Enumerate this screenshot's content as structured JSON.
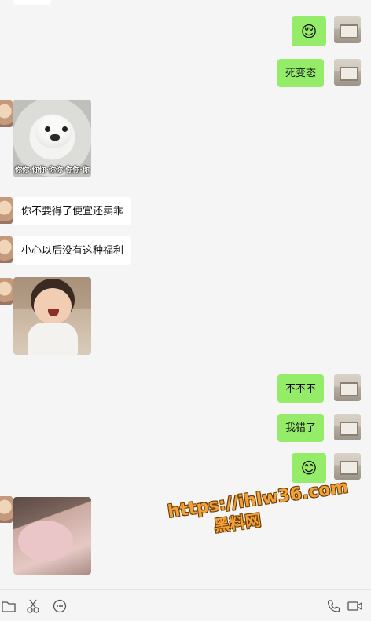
{
  "messages": [
    {
      "side": "left",
      "kind": "text",
      "text": ""
    },
    {
      "side": "right",
      "kind": "emoji",
      "emoji": "😌"
    },
    {
      "side": "right",
      "kind": "text",
      "text": "死变态"
    },
    {
      "side": "left",
      "kind": "image",
      "image": "dog-sticker",
      "caption": "你你·你你·你你·你你·你"
    },
    {
      "side": "left",
      "kind": "text",
      "text": "你不要得了便宜还卖乖"
    },
    {
      "side": "left",
      "kind": "text",
      "text": "小心以后没有这种福利"
    },
    {
      "side": "left",
      "kind": "image",
      "image": "laughing-kid-photo"
    },
    {
      "side": "right",
      "kind": "text",
      "text": "不不不"
    },
    {
      "side": "right",
      "kind": "text",
      "text": "我错了"
    },
    {
      "side": "right",
      "kind": "emoji",
      "emoji": "😊"
    },
    {
      "side": "left",
      "kind": "image",
      "image": "baby-photo"
    }
  ],
  "watermark": {
    "url": "https://ihlw36.com",
    "text": "黑料网"
  },
  "toolbar": {
    "left_icons": [
      "folder-icon",
      "scissors-icon",
      "chat-bubble-icon"
    ],
    "right_icons": [
      "phone-icon",
      "video-call-icon"
    ]
  },
  "colors": {
    "outgoing_bubble": "#95ec69",
    "incoming_bubble": "#ffffff",
    "background": "#f5f5f5"
  }
}
